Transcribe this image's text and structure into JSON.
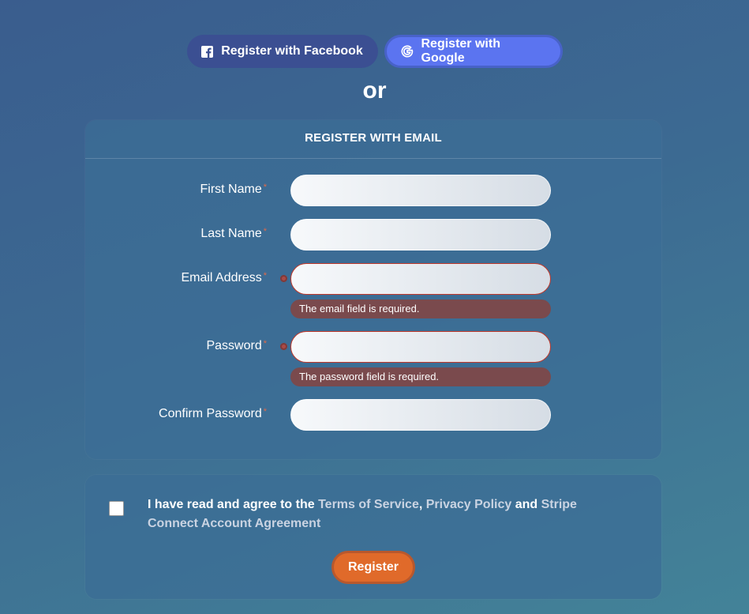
{
  "social": {
    "facebook_label": "Register with Facebook",
    "facebook_icon": "facebook-icon",
    "google_label": "Register with Google",
    "google_icon": "google-icon"
  },
  "or_text": "or",
  "email_form": {
    "header": "REGISTER WITH EMAIL",
    "required_mark": "*",
    "fields": [
      {
        "label": "First Name",
        "value": "",
        "placeholder": ""
      },
      {
        "label": "Last Name",
        "value": "",
        "placeholder": ""
      },
      {
        "label": "Email Address",
        "value": "",
        "placeholder": "",
        "error": "The email field is required."
      },
      {
        "label": "Password",
        "value": "",
        "placeholder": "",
        "error": "The password field is required."
      },
      {
        "label": "Confirm Password",
        "value": "",
        "placeholder": ""
      }
    ]
  },
  "terms": {
    "checked": false,
    "prefix": "I have read and agree to the ",
    "tos_link": "Terms of Service",
    "comma": ", ",
    "privacy_link": "Privacy Policy",
    "and": " and ",
    "stripe_link": "Stripe Connect Account Agreement"
  },
  "register_label": "Register",
  "colors": {
    "accent_orange": "#e06a2a",
    "facebook_blue": "#3b4f92",
    "google_blue": "#5b74f0",
    "error_bg": "#7a4a4d",
    "required_mark": "#e06a4a"
  }
}
